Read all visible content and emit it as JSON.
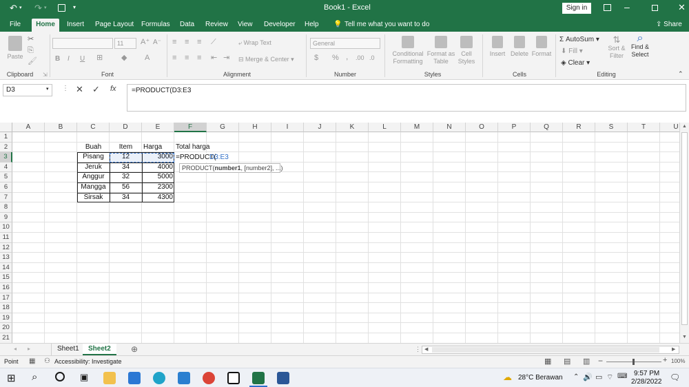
{
  "title": {
    "window": "Book1  -  Excel",
    "signin": "Sign in"
  },
  "tabs": [
    "File",
    "Home",
    "Insert",
    "Page Layout",
    "Formulas",
    "Data",
    "Review",
    "View",
    "Developer",
    "Help"
  ],
  "tellme": "Tell me what you want to do",
  "share": "Share",
  "ribbon": {
    "clipboard": {
      "label": "Clipboard",
      "paste": "Paste"
    },
    "font": {
      "label": "Font",
      "size": "11",
      "bold": "B",
      "italic": "I",
      "underline": "U"
    },
    "alignment": {
      "label": "Alignment",
      "wrap": "Wrap Text",
      "merge": "Merge & Center"
    },
    "number": {
      "label": "Number",
      "format": "General",
      "currency": "$",
      "percent": "%",
      "comma": ","
    },
    "styles": {
      "label": "Styles",
      "conditional": "Conditional Formatting",
      "format_as": "Format as Table",
      "cell_styles": "Cell Styles"
    },
    "cells": {
      "label": "Cells",
      "insert": "Insert",
      "delete": "Delete",
      "format": "Format"
    },
    "editing": {
      "label": "Editing",
      "autosum": "AutoSum",
      "fill": "Fill",
      "clear": "Clear",
      "sort": "Sort & Filter",
      "find": "Find & Select"
    }
  },
  "formula_bar": {
    "namebox": "D3",
    "formula": "=PRODUCT(D3:E3"
  },
  "columns": [
    "A",
    "B",
    "C",
    "D",
    "E",
    "F",
    "G",
    "H",
    "I",
    "J",
    "K",
    "L",
    "M",
    "N",
    "O",
    "P",
    "Q",
    "R",
    "S",
    "T",
    "U"
  ],
  "rows": [
    "1",
    "2",
    "3",
    "4",
    "5",
    "6",
    "7",
    "8",
    "9",
    "10",
    "11",
    "12",
    "13",
    "14",
    "15",
    "16",
    "17",
    "18",
    "19",
    "20",
    "21"
  ],
  "sheet": {
    "headers": {
      "buah": "Buah",
      "item": "Item",
      "harga": "Harga",
      "total": "Total harga"
    },
    "data": [
      {
        "buah": "Pisang",
        "item": "12",
        "harga": "3000"
      },
      {
        "buah": "Jeruk",
        "item": "34",
        "harga": "4000"
      },
      {
        "buah": "Anggur",
        "item": "32",
        "harga": "5000"
      },
      {
        "buah": "Mangga",
        "item": "56",
        "harga": "2300"
      },
      {
        "buah": "Sirsak",
        "item": "34",
        "harga": "4300"
      }
    ],
    "edit_prefix": "=PRODUCT(",
    "edit_ref": "D3:E3",
    "tooltip_fn": "PRODUCT(",
    "tooltip_arg1": "number1",
    "tooltip_rest": ", [number2], ...)"
  },
  "sheets": [
    "Sheet1",
    "Sheet2"
  ],
  "status": {
    "mode": "Point",
    "accessibility": "Accessibility: Investigate",
    "zoom": "100%"
  },
  "taskbar": {
    "weather": "28°C  Berawan",
    "time": "9:57 PM",
    "date": "2/28/2022"
  },
  "colors": {
    "accent": "#217346",
    "ref": "#2f6ec7"
  }
}
